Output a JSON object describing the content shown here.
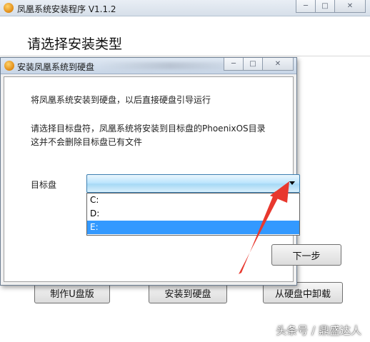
{
  "main_window": {
    "title": "凤凰系统安装程序 V1.1.2",
    "heading": "请选择安装类型",
    "buttons": {
      "make_usb": "制作U盘版",
      "install_disk": "安装到硬盘",
      "uninstall": "从硬盘中卸载"
    },
    "controls": {
      "minimize": "─",
      "maximize": "□",
      "close": "✕"
    }
  },
  "dialog": {
    "title": "安装凤凰系统到硬盘",
    "line1": "将凤凰系统安装到硬盘，以后直接硬盘引导运行",
    "line2": "请选择目标盘符，凤凰系统将安装到目标盘的PhoenixOS目录",
    "line3": "这并不会删除目标盘已有文件",
    "target_label": "目标盘",
    "options": [
      "C:",
      "D:",
      "E:"
    ],
    "selected_option": "E:",
    "next_button": "下一步",
    "controls": {
      "minimize": "─",
      "maximize": "□",
      "close": "✕"
    }
  },
  "watermark": "头条号 / 鼎盛达人",
  "icons": [
    "phoenix-app-icon",
    "dropdown-arrow-icon",
    "annotation-arrow"
  ],
  "colors": {
    "selection": "#3399ff",
    "combo_border": "#3c7fb1",
    "annotation": "#e8382e"
  }
}
